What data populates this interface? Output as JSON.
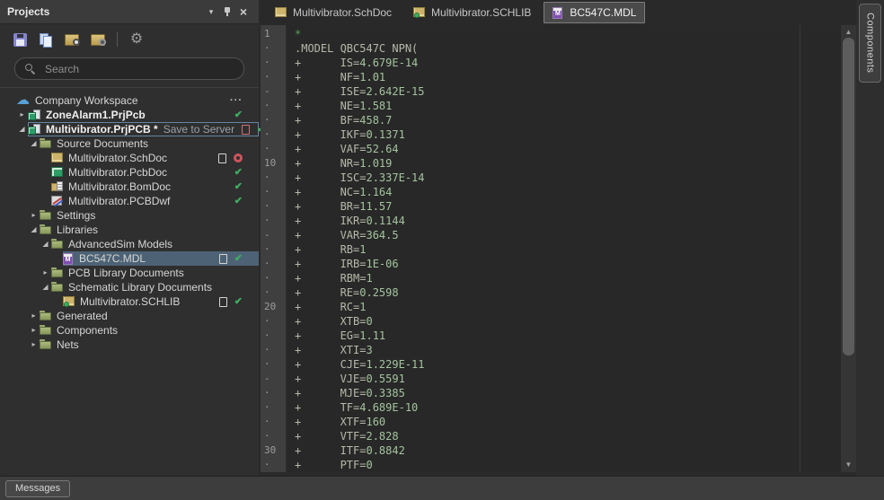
{
  "panel": {
    "title": "Projects",
    "header_icons": [
      "dropdown-arrow",
      "pin",
      "close"
    ],
    "toolbar": [
      {
        "id": "save"
      },
      {
        "id": "copy-documents"
      },
      {
        "id": "open-project-folder"
      },
      {
        "id": "project-folder-settings"
      },
      {
        "id": "divider"
      },
      {
        "id": "settings-gear"
      }
    ],
    "search": {
      "placeholder": "Search"
    },
    "tree": [
      {
        "level": 0,
        "icon": "cloud",
        "label": "Company Workspace",
        "expand": "none",
        "trailing": [
          "ellipsis"
        ]
      },
      {
        "level": 1,
        "icon": "project",
        "label": "ZoneAlarm1.PrjPcb",
        "bold": true,
        "expand": "collapsed",
        "trailing": [
          "check"
        ]
      },
      {
        "level": 1,
        "icon": "project",
        "label": "Multivibrator.PrjPCB *",
        "suffix": "Save to Server",
        "bold": true,
        "expand": "expanded",
        "focused": true,
        "trailing": [
          "doc-red",
          "check"
        ]
      },
      {
        "level": 2,
        "icon": "folder",
        "label": "Source Documents",
        "expand": "expanded"
      },
      {
        "level": 3,
        "icon": "schdoc",
        "label": "Multivibrator.SchDoc",
        "expand": "none",
        "trailing": [
          "doc",
          "record"
        ]
      },
      {
        "level": 3,
        "icon": "pcbdoc",
        "label": "Multivibrator.PcbDoc",
        "expand": "none",
        "trailing": [
          "check"
        ]
      },
      {
        "level": 3,
        "icon": "bomdoc",
        "label": "Multivibrator.BomDoc",
        "expand": "none",
        "trailing": [
          "check"
        ]
      },
      {
        "level": 3,
        "icon": "pcbdwf",
        "label": "Multivibrator.PCBDwf",
        "expand": "none",
        "trailing": [
          "check"
        ]
      },
      {
        "level": 2,
        "icon": "folder",
        "label": "Settings",
        "expand": "collapsed"
      },
      {
        "level": 2,
        "icon": "folder",
        "label": "Libraries",
        "expand": "expanded"
      },
      {
        "level": 3,
        "icon": "folder",
        "label": "AdvancedSim Models",
        "expand": "expanded"
      },
      {
        "level": 4,
        "icon": "mdl",
        "label": "BC547C.MDL",
        "expand": "none",
        "selected": true,
        "trailing": [
          "doc",
          "check"
        ]
      },
      {
        "level": 3,
        "icon": "folder",
        "label": "PCB Library Documents",
        "expand": "collapsed"
      },
      {
        "level": 3,
        "icon": "folder",
        "label": "Schematic Library Documents",
        "expand": "expanded"
      },
      {
        "level": 4,
        "icon": "schlib",
        "label": "Multivibrator.SCHLIB",
        "expand": "none",
        "trailing": [
          "doc",
          "check"
        ]
      },
      {
        "level": 2,
        "icon": "folder",
        "label": "Generated",
        "expand": "collapsed"
      },
      {
        "level": 2,
        "icon": "folder",
        "label": "Components",
        "expand": "collapsed"
      },
      {
        "level": 2,
        "icon": "folder",
        "label": "Nets",
        "expand": "collapsed"
      }
    ]
  },
  "tabs": [
    {
      "label": "Multivibrator.SchDoc",
      "icon": "schdoc",
      "active": false
    },
    {
      "label": "Multivibrator.SCHLIB",
      "icon": "schlib",
      "active": false
    },
    {
      "label": "BC547C.MDL",
      "icon": "mdl",
      "active": true
    }
  ],
  "editor": {
    "lines": [
      {
        "g": "1",
        "t": "*",
        "comment": true
      },
      {
        "g": "·",
        "t": ".MODEL QBC547C NPN("
      },
      {
        "g": "·",
        "t": "+      IS=4.679E-14"
      },
      {
        "g": "·",
        "t": "+      NF=1.01"
      },
      {
        "g": "-",
        "t": "+      ISE=2.642E-15"
      },
      {
        "g": "·",
        "t": "+      NE=1.581"
      },
      {
        "g": "·",
        "t": "+      BF=458.7"
      },
      {
        "g": "·",
        "t": "+      IKF=0.1371"
      },
      {
        "g": "·",
        "t": "+      VAF=52.64"
      },
      {
        "g": "10",
        "t": "+      NR=1.019"
      },
      {
        "g": "·",
        "t": "+      ISC=2.337E-14"
      },
      {
        "g": "·",
        "t": "+      NC=1.164"
      },
      {
        "g": "·",
        "t": "+      BR=11.57"
      },
      {
        "g": "·",
        "t": "+      IKR=0.1144"
      },
      {
        "g": "-",
        "t": "+      VAR=364.5"
      },
      {
        "g": "·",
        "t": "+      RB=1"
      },
      {
        "g": "·",
        "t": "+      IRB=1E-06"
      },
      {
        "g": "·",
        "t": "+      RBM=1"
      },
      {
        "g": "·",
        "t": "+      RE=0.2598"
      },
      {
        "g": "20",
        "t": "+      RC=1"
      },
      {
        "g": "·",
        "t": "+      XTB=0"
      },
      {
        "g": "·",
        "t": "+      EG=1.11"
      },
      {
        "g": "·",
        "t": "+      XTI=3"
      },
      {
        "g": "·",
        "t": "+      CJE=1.229E-11"
      },
      {
        "g": "-",
        "t": "+      VJE=0.5591"
      },
      {
        "g": "·",
        "t": "+      MJE=0.3385"
      },
      {
        "g": "·",
        "t": "+      TF=4.689E-10"
      },
      {
        "g": "·",
        "t": "+      XTF=160"
      },
      {
        "g": "·",
        "t": "+      VTF=2.828"
      },
      {
        "g": "30",
        "t": "+      ITF=0.8842"
      },
      {
        "g": "·",
        "t": "+      PTF=0"
      }
    ]
  },
  "right_tab": {
    "label": "Components"
  },
  "status_bar": {
    "messages_label": "Messages"
  },
  "colors": {
    "selection": "#4d6375",
    "check_green": "#3fae62",
    "record_red": "#d0545e",
    "comment_green": "#54a254",
    "folder_khaki": "#97a668",
    "mdl_purple": "#7e4fb0",
    "panel_bg": "#2f2f2f",
    "editor_bg": "#282828"
  }
}
